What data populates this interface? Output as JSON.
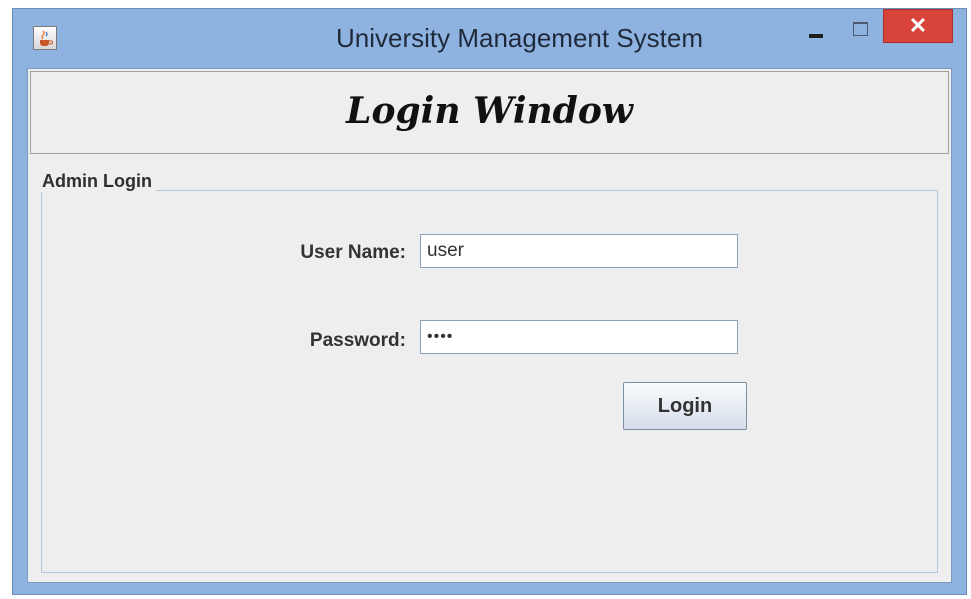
{
  "window": {
    "title": "University Management System",
    "app_icon": "java-cup-icon",
    "controls": {
      "minimize_icon": "minimize-icon",
      "maximize_icon": "maximize-icon",
      "close_icon": "close-icon",
      "close_glyph": "✕"
    },
    "colors": {
      "frame": "#8fb3e0",
      "close_button": "#d9443a",
      "client_background": "#eeeeee"
    }
  },
  "header": {
    "title": "Login Window"
  },
  "form": {
    "legend": "Admin Login",
    "username_label": "User Name:",
    "username_value": "user",
    "password_label": "Password:",
    "password_value": "••••",
    "login_button": "Login"
  }
}
